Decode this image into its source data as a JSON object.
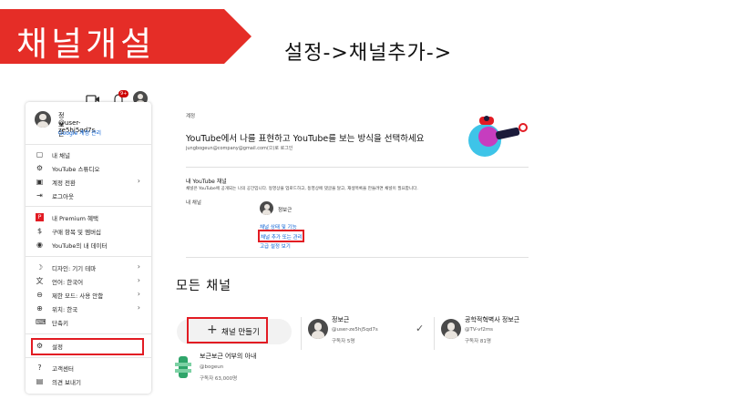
{
  "banner": {
    "title": "채널개설"
  },
  "caption": "설정->채널추가->",
  "topbar": {
    "notification_count": "9+"
  },
  "profile": {
    "name": "정보근",
    "handle": "@user-ze5hj5qd7s",
    "manage_link": "Google 계정 관리"
  },
  "menu": {
    "items": [
      {
        "icon": "person-icon",
        "label": "내 채널",
        "chevron": ""
      },
      {
        "icon": "studio-icon",
        "label": "YouTube 스튜디오",
        "chevron": ""
      },
      {
        "icon": "switch-account-icon",
        "label": "계정 전환",
        "chevron": "›"
      },
      {
        "icon": "logout-icon",
        "label": "로그아웃",
        "chevron": ""
      },
      {
        "icon": "premium-icon",
        "label": "내 Premium 혜택",
        "chevron": ""
      },
      {
        "icon": "purchases-icon",
        "label": "구매 항목 및 멤버십",
        "chevron": ""
      },
      {
        "icon": "your-data-icon",
        "label": "YouTube의 내 데이터",
        "chevron": ""
      },
      {
        "icon": "appearance-icon",
        "label": "디자인: 기기 테마",
        "chevron": "›"
      },
      {
        "icon": "language-icon",
        "label": "언어: 한국어",
        "chevron": "›"
      },
      {
        "icon": "restricted-mode-icon",
        "label": "제한 모드: 사용 안함",
        "chevron": "›"
      },
      {
        "icon": "location-icon",
        "label": "위치: 한국",
        "chevron": "›"
      },
      {
        "icon": "keyboard-icon",
        "label": "단축키",
        "chevron": ""
      },
      {
        "icon": "settings-icon",
        "label": "설정",
        "chevron": ""
      },
      {
        "icon": "help-icon",
        "label": "고객센터",
        "chevron": ""
      },
      {
        "icon": "feedback-icon",
        "label": "의견 보내기",
        "chevron": ""
      }
    ]
  },
  "settings": {
    "section_label": "계정",
    "headline": "YouTube에서 나를 표현하고 YouTube를 보는 방식을 선택하세요",
    "account_line": "jungbogeun@company@gmail.com(으)로 로그인",
    "your_channel_title": "내 YouTube 채널",
    "your_channel_desc": "채널은 YouTube에 공개되는 나의 공간입니다. 동영상을 업로드하고, 동영상에 댓글을 달고, 재생목록을 만들려면 채널이 필요합니다.",
    "my_channel_label": "내 채널",
    "channel_name": "정보근",
    "link_status": "채널 상태 및 기능",
    "link_add_manage": "채널 추가 또는 관리",
    "link_advanced": "고급 설정 보기"
  },
  "all_channels": {
    "title": "모든 채널",
    "create_button": "채널 만들기",
    "channels": [
      {
        "name": "정보근",
        "handle": "@user-ze5hj5qd7s",
        "subs": "구독자 5명",
        "selected": "✓"
      },
      {
        "name": "공학적혁벽사 정보근",
        "handle": "@TV-vf2ms",
        "subs": "구독자 81명",
        "selected": ""
      },
      {
        "name": "보근보근 어부의 아내",
        "handle": "@bogeun",
        "subs": "구독자 63,000명",
        "selected": ""
      }
    ]
  },
  "colors": {
    "accent_red": "#e21b23",
    "banner_red": "#e52d27",
    "link_blue": "#065fd4"
  }
}
